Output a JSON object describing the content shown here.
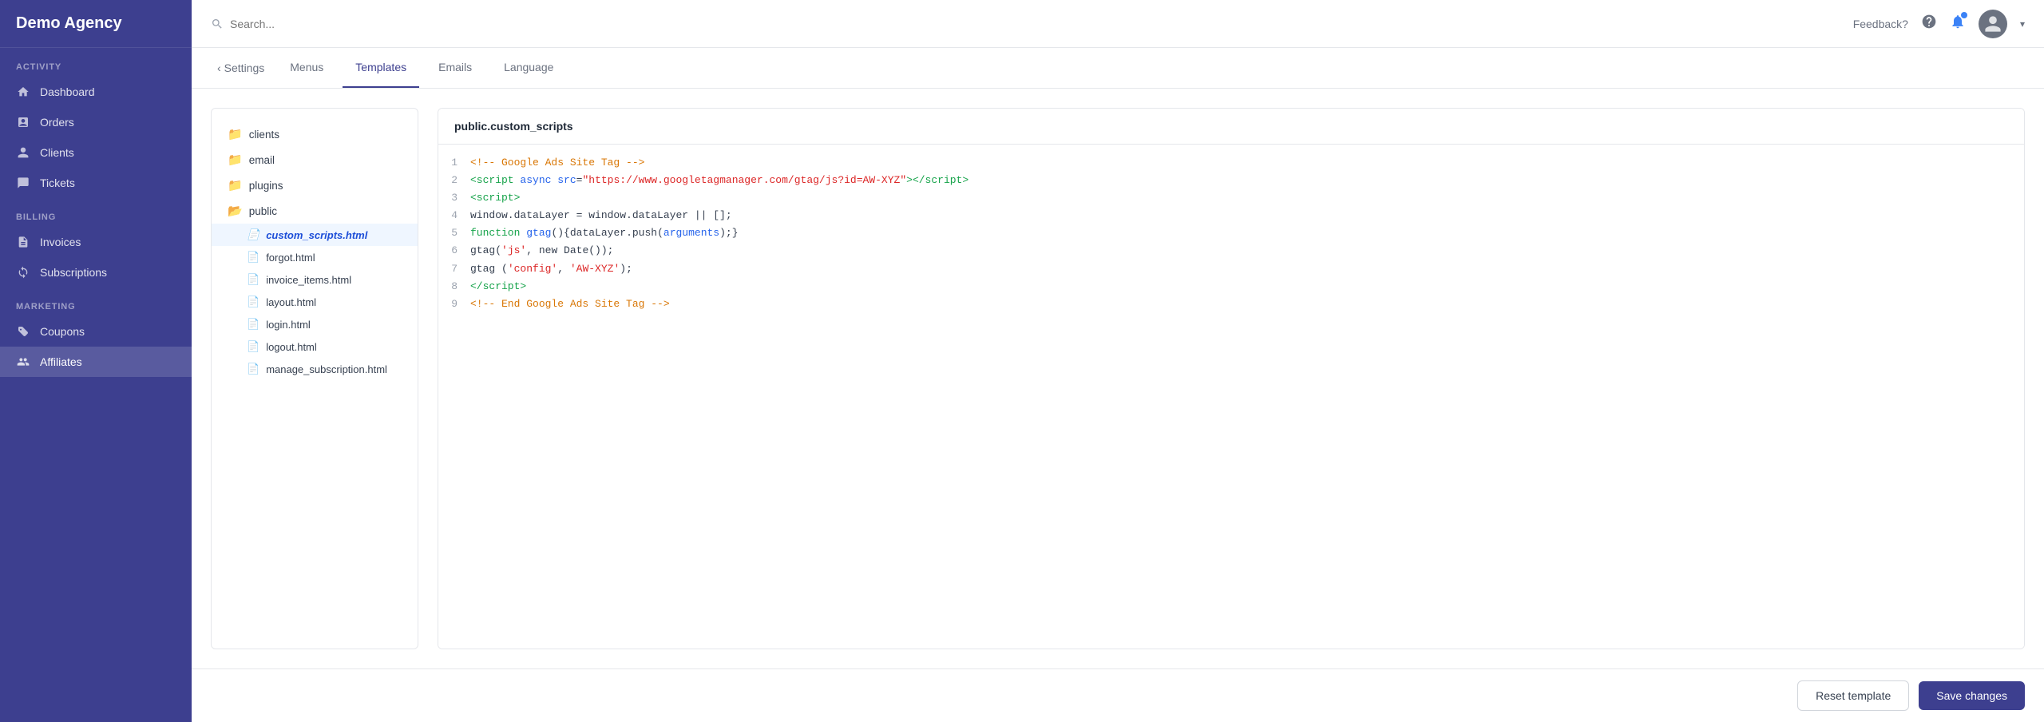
{
  "sidebar": {
    "brand": "Demo Agency",
    "sections": [
      {
        "label": "ACTIVITY",
        "items": [
          {
            "id": "dashboard",
            "label": "Dashboard",
            "icon": "home"
          },
          {
            "id": "orders",
            "label": "Orders",
            "icon": "orders"
          },
          {
            "id": "clients",
            "label": "Clients",
            "icon": "clients"
          },
          {
            "id": "tickets",
            "label": "Tickets",
            "icon": "tickets"
          }
        ]
      },
      {
        "label": "BILLING",
        "items": [
          {
            "id": "invoices",
            "label": "Invoices",
            "icon": "invoices"
          },
          {
            "id": "subscriptions",
            "label": "Subscriptions",
            "icon": "subscriptions"
          }
        ]
      },
      {
        "label": "MARKETING",
        "items": [
          {
            "id": "coupons",
            "label": "Coupons",
            "icon": "coupons"
          },
          {
            "id": "affiliates",
            "label": "Affiliates",
            "icon": "affiliates"
          }
        ]
      }
    ]
  },
  "topbar": {
    "search_placeholder": "Search...",
    "feedback_label": "Feedback?",
    "notification_count": 1
  },
  "tabs": [
    {
      "id": "settings",
      "label": "Settings",
      "back": true
    },
    {
      "id": "menus",
      "label": "Menus"
    },
    {
      "id": "templates",
      "label": "Templates",
      "active": true
    },
    {
      "id": "emails",
      "label": "Emails"
    },
    {
      "id": "language",
      "label": "Language"
    }
  ],
  "file_tree": {
    "folders": [
      {
        "name": "clients",
        "files": []
      },
      {
        "name": "email",
        "files": []
      },
      {
        "name": "plugins",
        "files": []
      },
      {
        "name": "public",
        "files": [
          {
            "name": "custom_scripts.html",
            "active": true
          },
          {
            "name": "forgot.html"
          },
          {
            "name": "invoice_items.html"
          },
          {
            "name": "layout.html"
          },
          {
            "name": "login.html"
          },
          {
            "name": "logout.html"
          },
          {
            "name": "manage_subscription.html"
          }
        ]
      }
    ]
  },
  "code_editor": {
    "title": "public.custom_scripts",
    "lines": [
      {
        "num": 1,
        "html": "<span class='c-comment'>&lt;!-- Google Ads Site Tag --&gt;</span>"
      },
      {
        "num": 2,
        "html": "<span class='c-tag'>&lt;script</span> <span class='c-attr'>async</span> <span class='c-attr'>src</span>=<span class='c-string'>\"https://www.googletagmanager.com/gtag/js?id=AW-XYZ\"</span><span class='c-tag'>&gt;&lt;/script&gt;</span>"
      },
      {
        "num": 3,
        "html": "<span class='c-tag'>&lt;script&gt;</span>"
      },
      {
        "num": 4,
        "html": "<span class='c-plain'>window.dataLayer = window.dataLayer || [];</span>"
      },
      {
        "num": 5,
        "html": "<span class='c-keyword'>function</span> <span class='c-fn'>gtag</span><span class='c-plain'>(){dataLayer.push(</span><span class='c-fn'>arguments</span><span class='c-plain'>);}</span>"
      },
      {
        "num": 6,
        "html": "<span class='c-plain'>gtag(</span><span class='c-string'>'js'</span><span class='c-plain'>, new Date());</span>"
      },
      {
        "num": 7,
        "html": "<span class='c-plain'>gtag (</span><span class='c-string'>'config'</span><span class='c-plain'>, </span><span class='c-string'>'AW-XYZ'</span><span class='c-plain'>);</span>"
      },
      {
        "num": 8,
        "html": "<span class='c-tag'>&lt;/script&gt;</span>"
      },
      {
        "num": 9,
        "html": "<span class='c-comment'>&lt;!-- End Google Ads Site Tag --&gt;</span>"
      }
    ]
  },
  "actions": {
    "reset_label": "Reset template",
    "save_label": "Save changes"
  }
}
